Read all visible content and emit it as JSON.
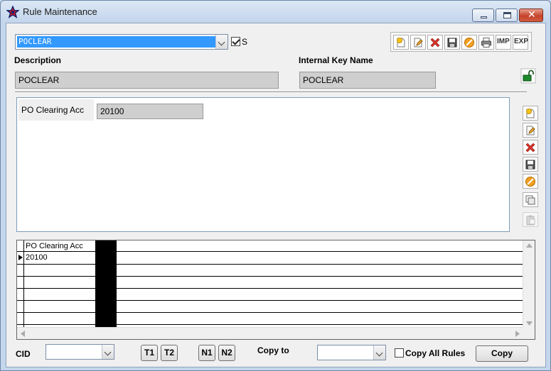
{
  "window": {
    "title": "Rule Maintenance"
  },
  "header": {
    "rule_select": {
      "value": "POCLEAR"
    },
    "s_checkbox": {
      "label": "S",
      "checked": true
    },
    "description_label": "Description",
    "description_value": "POCLEAR",
    "internal_key_label": "Internal Key Name",
    "internal_key_value": "POCLEAR"
  },
  "toolbar": {
    "items": [
      "new-icon",
      "edit-icon",
      "delete-icon",
      "save-icon",
      "cancel-icon",
      "print-icon",
      "import",
      "export"
    ],
    "imp_label": "IMP",
    "exp_label": "EXP"
  },
  "detail": {
    "field_label": "PO Clearing Acc",
    "field_value": "20100"
  },
  "grid": {
    "columns": [
      "PO Clearing Acc"
    ],
    "rows": [
      [
        "20100"
      ]
    ]
  },
  "footer": {
    "cid_label": "CID",
    "cid_value": "",
    "t1": "T1",
    "t2": "T2",
    "n1": "N1",
    "n2": "N2",
    "copy_to_label": "Copy to",
    "copy_to_value": "",
    "copy_all_rules_label": "Copy All Rules",
    "copy_all_rules_checked": false,
    "copy_button": "Copy"
  },
  "colors": {
    "selection": "#3399ff",
    "readonly_field": "#cfcfcf",
    "delete_red": "#d9342b",
    "cancel_orange": "#f0a020"
  }
}
